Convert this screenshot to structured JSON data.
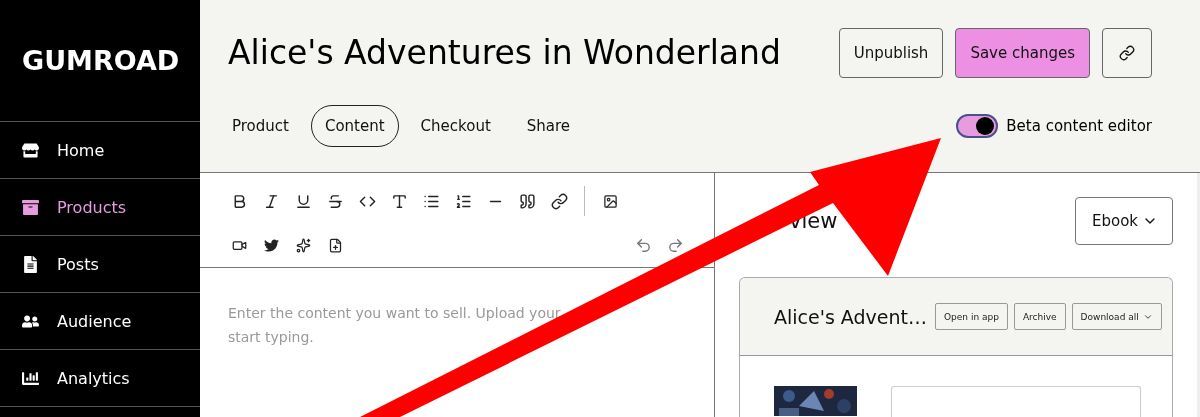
{
  "sidebar": {
    "logo": "GUMROAD",
    "items": [
      {
        "label": "Home",
        "selected": false
      },
      {
        "label": "Products",
        "selected": true
      },
      {
        "label": "Posts",
        "selected": false
      },
      {
        "label": "Audience",
        "selected": false
      },
      {
        "label": "Analytics",
        "selected": false
      }
    ]
  },
  "header": {
    "title": "Alice's Adventures in Wonderland",
    "buttons": [
      {
        "label": "Unpublish",
        "kind": "secondary"
      },
      {
        "label": "Save changes",
        "kind": "primary"
      }
    ],
    "tabs": [
      {
        "label": "Product",
        "selected": false
      },
      {
        "label": "Content",
        "selected": true
      },
      {
        "label": "Checkout",
        "selected": false
      },
      {
        "label": "Share",
        "selected": false
      }
    ],
    "beta_toggle": {
      "label": "Beta content editor",
      "on": true
    }
  },
  "editor": {
    "placeholder_lines": [
      "Enter the content you want to sell. Upload your",
      "start typing."
    ]
  },
  "preview": {
    "title": "view",
    "format": "Ebook",
    "card": {
      "title": "Alice's Advent…",
      "buttons": [
        {
          "label": "Open in app",
          "dropdown": false
        },
        {
          "label": "Archive",
          "dropdown": false
        },
        {
          "label": "Download all",
          "dropdown": true
        }
      ]
    }
  }
}
